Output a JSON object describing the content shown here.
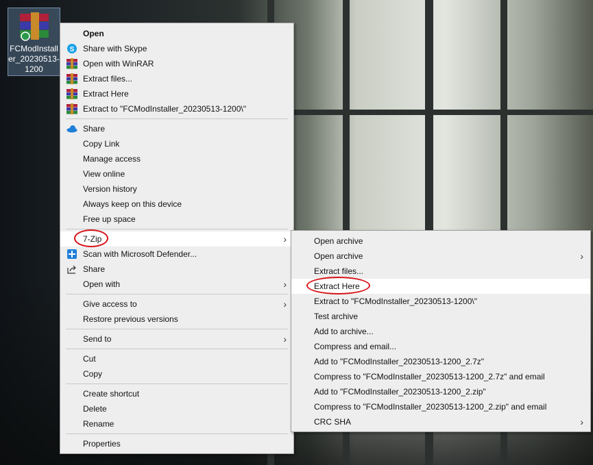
{
  "desktop_icon": {
    "label_line1": "FCModInstall",
    "label_line2": "er_20230513-",
    "label_line3": "1200"
  },
  "context_menu": {
    "group1": [
      {
        "label": "Open",
        "icon": "none"
      },
      {
        "label": "Share with Skype",
        "icon": "skype-icon"
      },
      {
        "label": "Open with WinRAR",
        "icon": "winrar-icon"
      },
      {
        "label": "Extract files...",
        "icon": "winrar-icon"
      },
      {
        "label": "Extract Here",
        "icon": "winrar-icon"
      },
      {
        "label": "Extract to \"FCModInstaller_20230513-1200\\\"",
        "icon": "winrar-icon"
      }
    ],
    "group2": [
      {
        "label": "Share",
        "icon": "onedrive-icon"
      },
      {
        "label": "Copy Link"
      },
      {
        "label": "Manage access"
      },
      {
        "label": "View online"
      },
      {
        "label": "Version history"
      },
      {
        "label": "Always keep on this device"
      },
      {
        "label": "Free up space"
      }
    ],
    "group3": [
      {
        "label": "7-Zip",
        "submenu": true
      },
      {
        "label": "Scan with Microsoft Defender...",
        "icon": "defender-icon"
      },
      {
        "label": "Share",
        "icon": "share-icon"
      },
      {
        "label": "Open with",
        "submenu": true
      }
    ],
    "group4": [
      {
        "label": "Give access to",
        "submenu": true
      },
      {
        "label": "Restore previous versions"
      }
    ],
    "group5": [
      {
        "label": "Send to",
        "submenu": true
      }
    ],
    "group6": [
      {
        "label": "Cut"
      },
      {
        "label": "Copy"
      }
    ],
    "group7": [
      {
        "label": "Create shortcut"
      },
      {
        "label": "Delete"
      },
      {
        "label": "Rename"
      }
    ],
    "group8": [
      {
        "label": "Properties"
      }
    ]
  },
  "submenu_7zip": [
    {
      "label": "Open archive"
    },
    {
      "label": "Open archive",
      "submenu": true
    },
    {
      "label": "Extract files..."
    },
    {
      "label": "Extract Here"
    },
    {
      "label": "Extract to \"FCModInstaller_20230513-1200\\\""
    },
    {
      "label": "Test archive"
    },
    {
      "label": "Add to archive..."
    },
    {
      "label": "Compress and email..."
    },
    {
      "label": "Add to \"FCModInstaller_20230513-1200_2.7z\""
    },
    {
      "label": "Compress to \"FCModInstaller_20230513-1200_2.7z\" and email"
    },
    {
      "label": "Add to \"FCModInstaller_20230513-1200_2.zip\""
    },
    {
      "label": "Compress to \"FCModInstaller_20230513-1200_2.zip\" and email"
    },
    {
      "label": "CRC SHA",
      "submenu": true
    }
  ],
  "colors": {
    "annotation": "#d8141a",
    "menu_bg": "#eeeeee",
    "highlight": "#ffffff"
  }
}
